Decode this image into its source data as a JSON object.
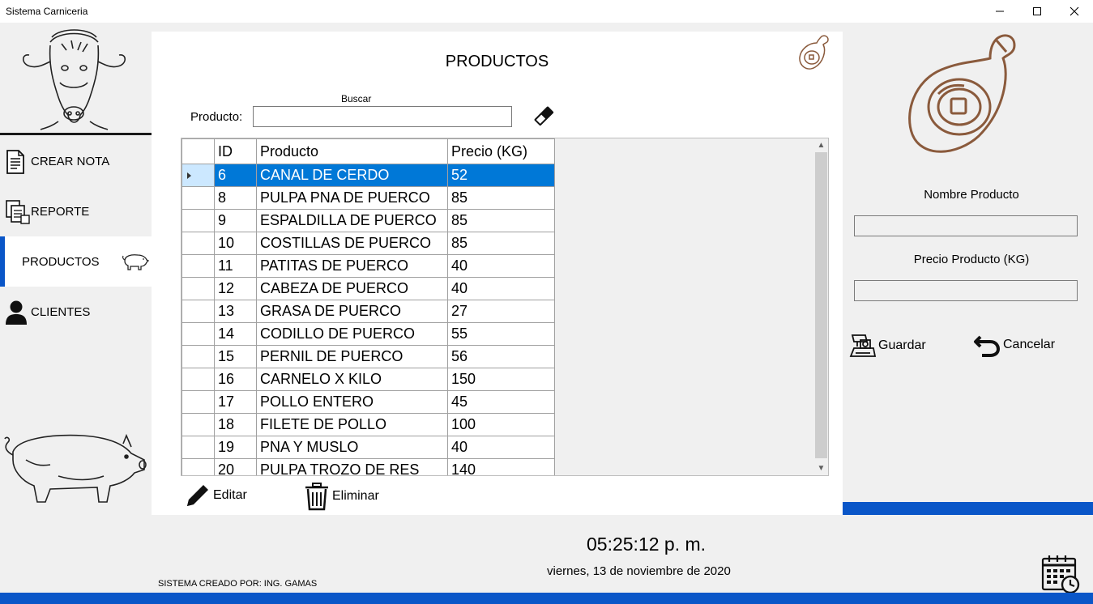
{
  "window": {
    "title": "Sistema Carniceria"
  },
  "colors": {
    "accent": "#0a56c8",
    "selection": "#0078d7",
    "selection_header": "#cce8ff"
  },
  "sidebar": {
    "items": [
      {
        "label": "CREAR NOTA",
        "icon": "document-icon"
      },
      {
        "label": "REPORTE",
        "icon": "report-icon"
      },
      {
        "label": "PRODUCTOS",
        "icon": "pig-icon",
        "active": true
      },
      {
        "label": "CLIENTES",
        "icon": "user-icon"
      }
    ]
  },
  "main": {
    "title": "PRODUCTOS",
    "search": {
      "caption": "Buscar",
      "label": "Producto:",
      "value": ""
    },
    "table": {
      "columns": [
        "ID",
        "Producto",
        "Precio (KG)"
      ],
      "rows": [
        [
          "6",
          "CANAL DE CERDO",
          "52"
        ],
        [
          "8",
          "PULPA PNA DE PUERCO",
          "85"
        ],
        [
          "9",
          "ESPALDILLA DE PUERCO",
          "85"
        ],
        [
          "10",
          "COSTILLAS DE PUERCO",
          "85"
        ],
        [
          "11",
          "PATITAS DE PUERCO",
          "40"
        ],
        [
          "12",
          "CABEZA DE PUERCO",
          "40"
        ],
        [
          "13",
          "GRASA DE PUERCO",
          "27"
        ],
        [
          "14",
          "CODILLO DE PUERCO",
          "55"
        ],
        [
          "15",
          "PERNIL DE PUERCO",
          "56"
        ],
        [
          "16",
          "CARNELO X KILO",
          "150"
        ],
        [
          "17",
          "POLLO ENTERO",
          "45"
        ],
        [
          "18",
          "FILETE DE POLLO",
          "100"
        ],
        [
          "19",
          "PNA Y MUSLO",
          "40"
        ],
        [
          "20",
          "PULPA TROZO DE RES",
          "140"
        ]
      ],
      "selected_row": 0
    },
    "edit_label": "Editar",
    "delete_label": "Eliminar"
  },
  "form": {
    "name_label": "Nombre Producto",
    "name_value": "",
    "price_label": "Precio Producto (KG)",
    "price_value": "",
    "save_label": "Guardar",
    "cancel_label": "Cancelar"
  },
  "footer": {
    "time": "05:25:12 p. m.",
    "date": "viernes, 13 de noviembre de 2020",
    "credit": "SISTEMA CREADO POR: ING. GAMAS"
  }
}
